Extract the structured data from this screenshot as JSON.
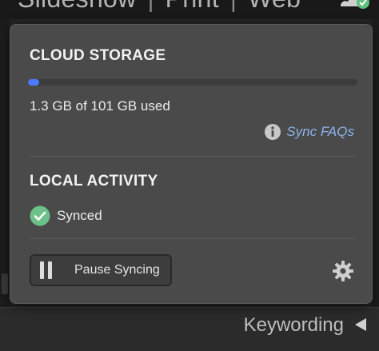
{
  "module_bar": {
    "modules": [
      "Slideshow",
      "Print",
      "Web"
    ],
    "separator": "|"
  },
  "popup": {
    "cloud_storage": {
      "title": "CLOUD STORAGE",
      "used_fraction": 0.013,
      "usage_text": "1.3 GB of 101 GB used",
      "faq_label": "Sync FAQs",
      "accent_color": "#4b7bff"
    },
    "local_activity": {
      "title": "LOCAL ACTIVITY",
      "status_text": "Synced",
      "status_color": "#6cc08a"
    },
    "footer": {
      "pause_label": "Pause Syncing"
    }
  },
  "lower_panel": {
    "keywording_label": "Keywording"
  },
  "icons": {
    "cloud": "cloud-sync-icon",
    "info": "info-icon",
    "check": "check-circle-icon",
    "pause": "pause-icon",
    "gear": "gear-icon",
    "collapse": "triangle-left-icon"
  }
}
